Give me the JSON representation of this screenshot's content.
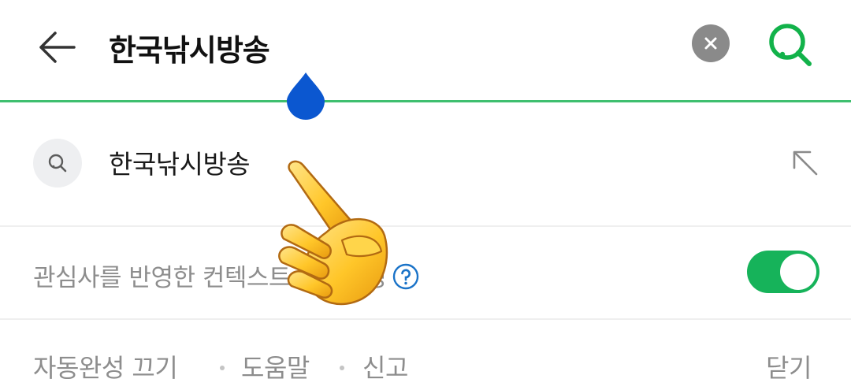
{
  "header": {
    "back_icon": "arrow-left-icon",
    "query": "한국낚시방송",
    "clear_icon": "close-icon",
    "search_icon": "search-icon",
    "accent_color": "#3fbf6f"
  },
  "suggestions": [
    {
      "icon": "search-icon",
      "text": "한국낚시방송",
      "fill_icon": "arrow-up-left-icon"
    }
  ],
  "personalized": {
    "label": "관심사를 반영한 컨텍스트 자동완성",
    "help_icon": "question-circle-icon",
    "toggle_on": true,
    "toggle_color": "#16b35a"
  },
  "footer": {
    "autocomplete_off": "자동완성 끄기",
    "help": "도움말",
    "report": "신고",
    "close": "닫기"
  },
  "overlay": {
    "icon": "pointing-hand-icon"
  }
}
